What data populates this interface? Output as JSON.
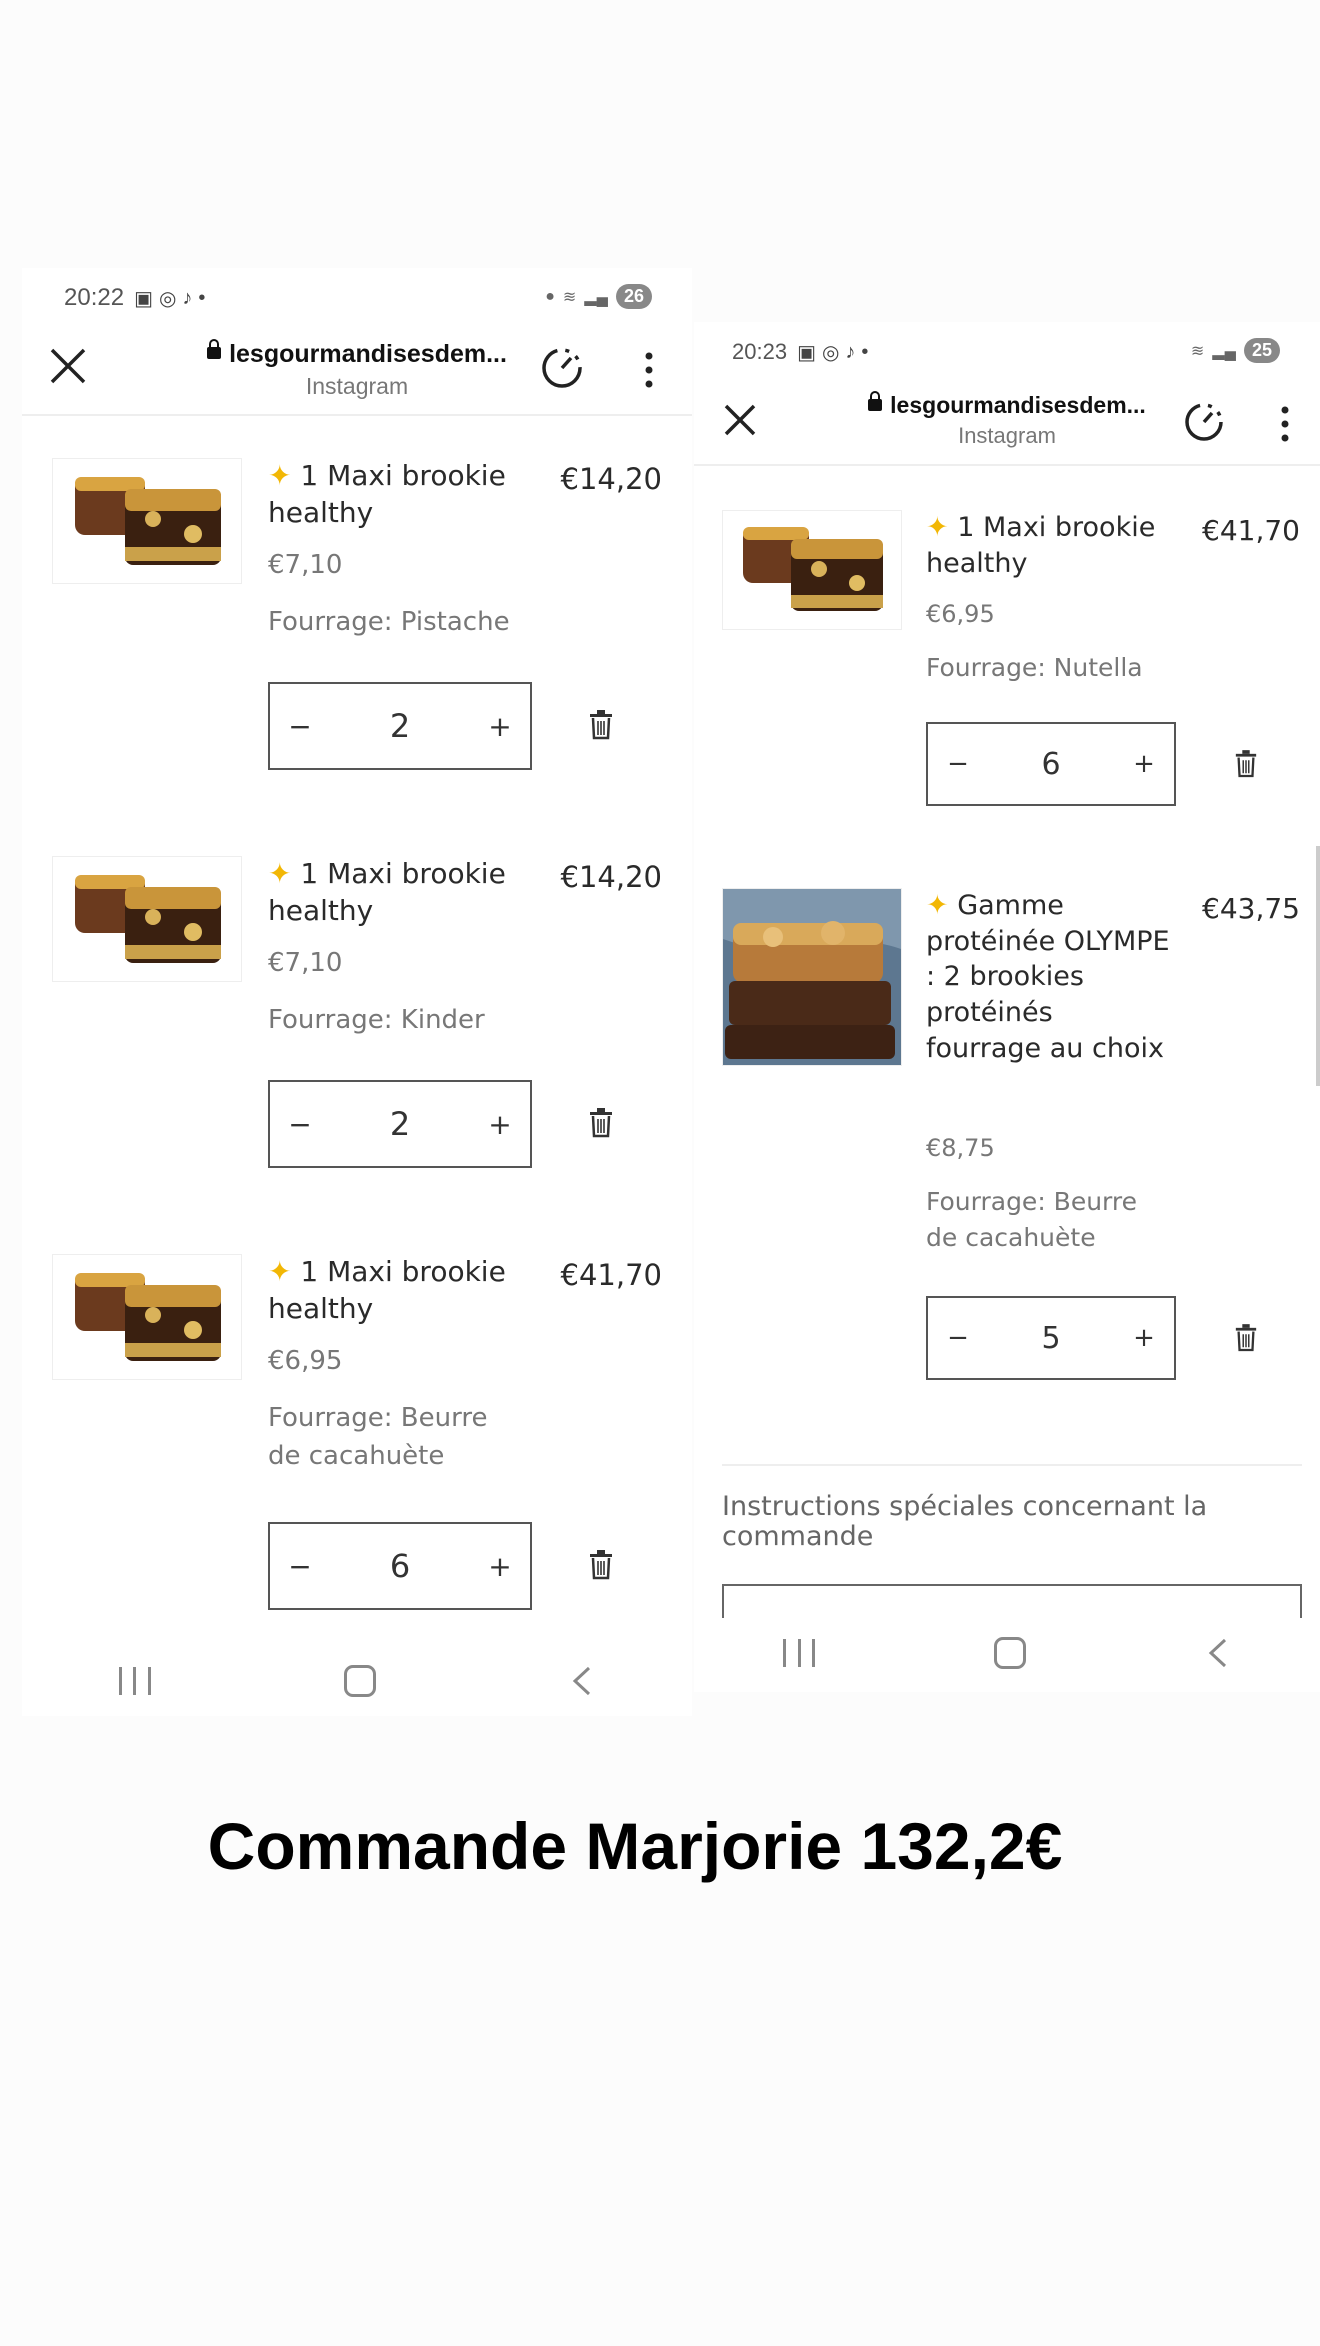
{
  "left": {
    "status": {
      "time": "20:22",
      "battery": "26"
    },
    "toolbar": {
      "url": "lesgourmandisesdem...",
      "source": "Instagram"
    },
    "items": [
      {
        "title": "1 Maxi brookie healthy",
        "price": "€14,20",
        "unit_price": "€7,10",
        "filling": "Fourrage: Pistache",
        "quantity": "2"
      },
      {
        "title": "1 Maxi brookie healthy",
        "price": "€14,20",
        "unit_price": "€7,10",
        "filling": "Fourrage: Kinder",
        "quantity": "2"
      },
      {
        "title": "1 Maxi brookie healthy",
        "price": "€41,70",
        "unit_price": "€6,95",
        "filling": "Fourrage: Beurre de cacahuète",
        "quantity": "6"
      }
    ]
  },
  "right": {
    "status": {
      "time": "20:23",
      "battery": "25"
    },
    "toolbar": {
      "url": "lesgourmandisesdem...",
      "source": "Instagram"
    },
    "items": [
      {
        "title": "1 Maxi brookie healthy",
        "price": "€41,70",
        "unit_price": "€6,95",
        "filling": "Fourrage: Nutella",
        "quantity": "6"
      },
      {
        "title": "Gamme protéinée OLYMPE : 2 brookies protéinés fourrage au choix",
        "price": "€43,75",
        "unit_price": "€8,75",
        "filling": "Fourrage: Beurre de cacahuète",
        "quantity": "5"
      }
    ],
    "instructions_label": "Instructions spéciales concernant la commande"
  },
  "caption": "Commande Marjorie 132,2€",
  "colors": {
    "sparkle": "#f2b705",
    "text": "#2a2a2a",
    "muted": "#777777"
  }
}
